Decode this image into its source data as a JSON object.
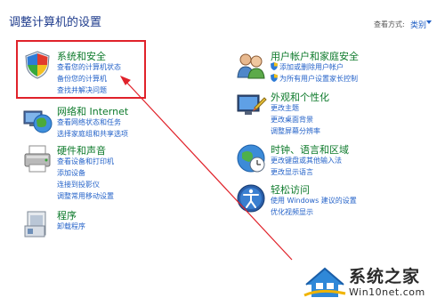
{
  "header": {
    "title": "调整计算机的设置",
    "view_by_label": "查看方式:",
    "view_by_value": "类别"
  },
  "categories": {
    "system": {
      "title": "系统和安全",
      "links": [
        "查看您的计算机状态",
        "备份您的计算机",
        "查找并解决问题"
      ]
    },
    "network": {
      "title": "网络和 Internet",
      "links": [
        "查看网络状态和任务",
        "选择家庭组和共享选项"
      ]
    },
    "hardware": {
      "title": "硬件和声音",
      "links": [
        "查看设备和打印机",
        "添加设备",
        "连接到投影仪",
        "调整常用移动设置"
      ]
    },
    "programs": {
      "title": "程序",
      "links": [
        "卸载程序"
      ]
    },
    "users": {
      "title": "用户帐户和家庭安全",
      "links": [
        "添加或删除用户帐户",
        "为所有用户设置家长控制"
      ]
    },
    "appearance": {
      "title": "外观和个性化",
      "links": [
        "更改主题",
        "更改桌面背景",
        "调整屏幕分辨率"
      ]
    },
    "clock": {
      "title": "时钟、语言和区域",
      "links": [
        "更改键盘或其他输入法",
        "更改显示语言"
      ]
    },
    "access": {
      "title": "轻松访问",
      "links": [
        "使用 Windows 建议的设置",
        "优化视频显示"
      ]
    }
  },
  "watermark": {
    "line1": "系统之家",
    "line2": "Win10net.com"
  }
}
